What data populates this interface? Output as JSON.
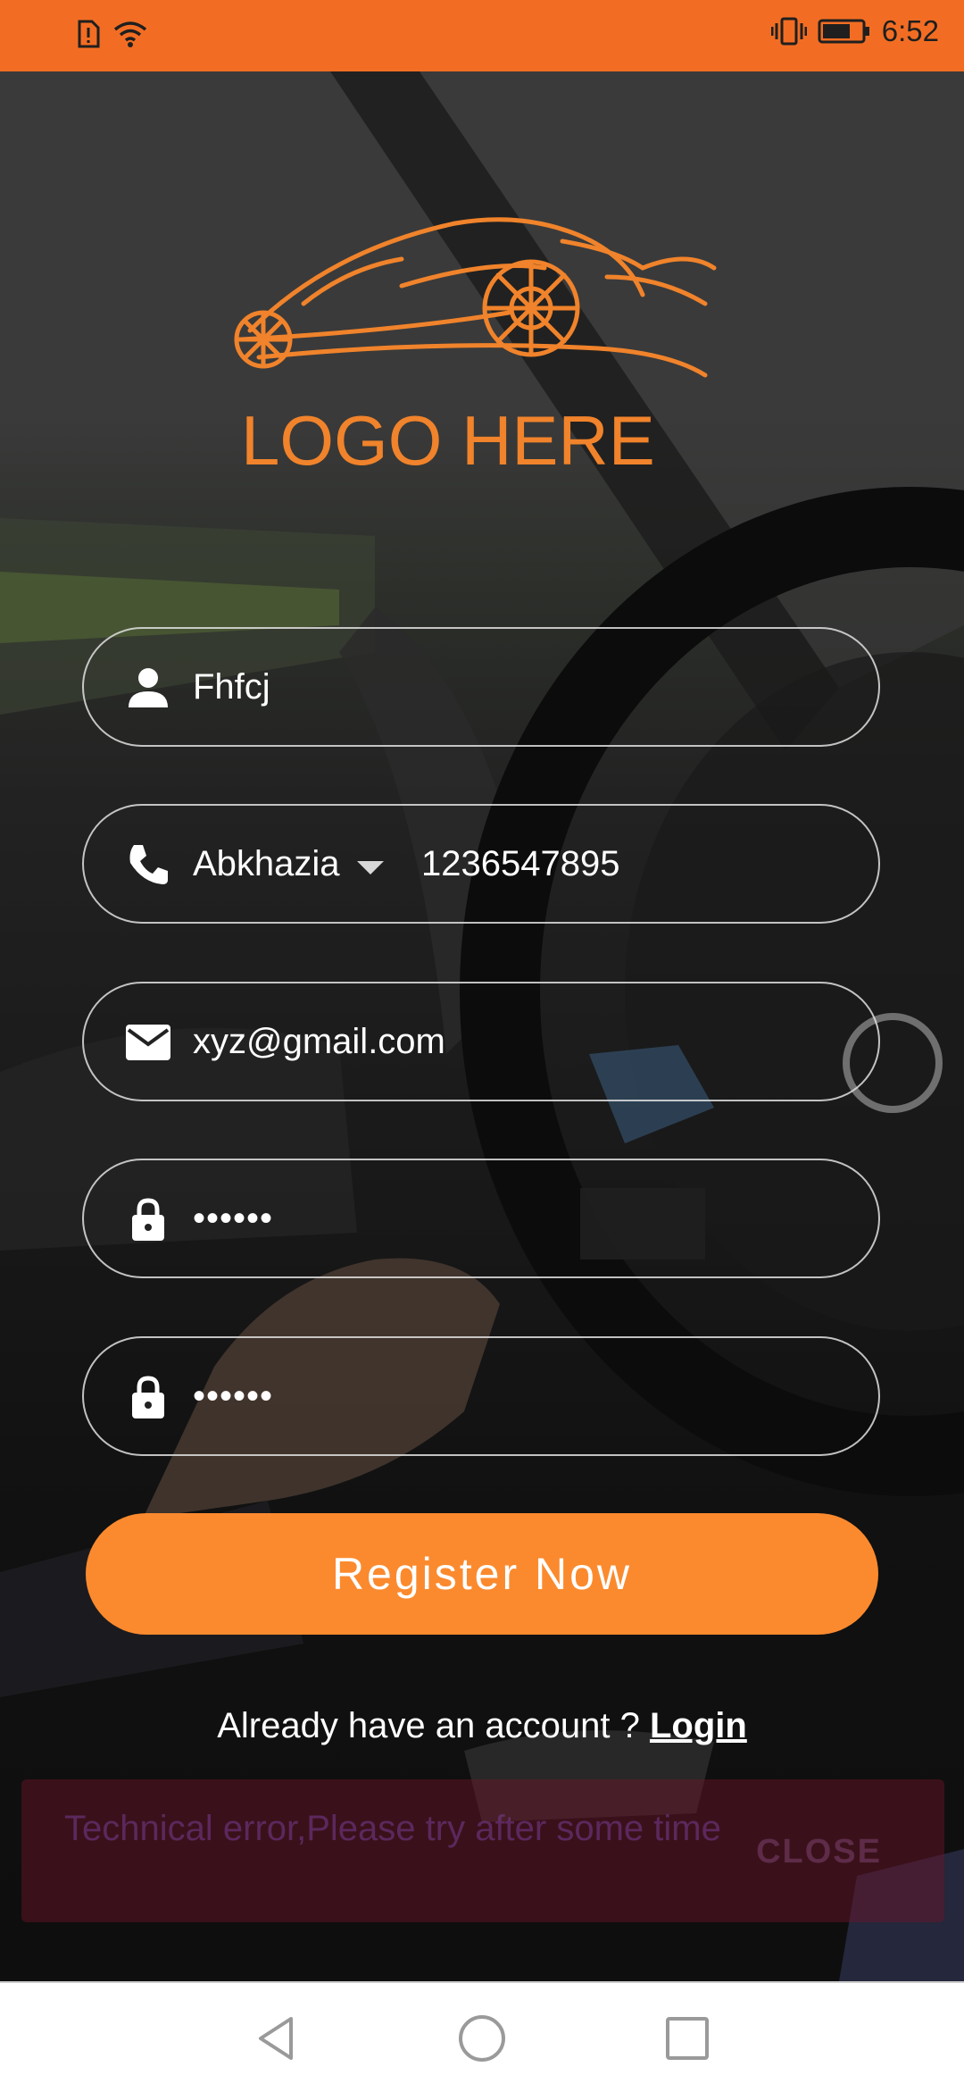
{
  "status_bar": {
    "time": "6:52"
  },
  "logo": {
    "text": "LOGO HERE"
  },
  "form": {
    "name_value": "Fhfcj",
    "country": "Abkhazia",
    "phone_value": "1236547895",
    "email_value": "xyz@gmail.com",
    "password_mask": "••••••",
    "confirm_password_mask": "••••••"
  },
  "register_label": "Register Now",
  "login_prompt": {
    "text": "Already have an account ? ",
    "link": "Login"
  },
  "snackbar": {
    "message": "Technical error,Please try after some time",
    "action": "CLOSE"
  },
  "colors": {
    "status_bar": "#f26d23",
    "accent": "#fb8a2e",
    "logo": "#f0832b"
  }
}
